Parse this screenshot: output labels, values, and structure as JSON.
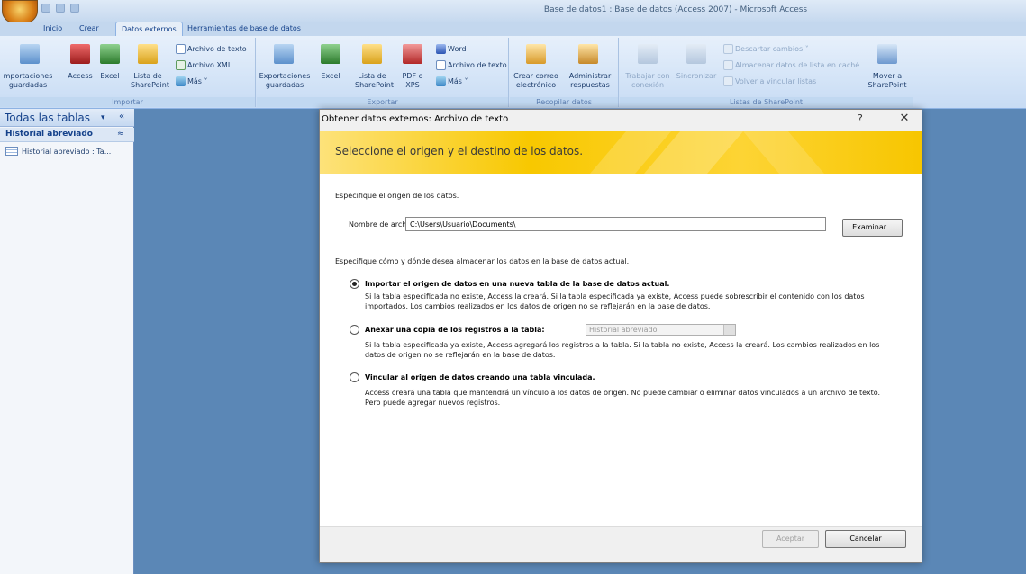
{
  "window": {
    "title": "Base de datos1 : Base de datos (Access 2007) - Microsoft Access"
  },
  "tabs": [
    {
      "label": "Inicio"
    },
    {
      "label": "Crear"
    },
    {
      "label": "Datos externos"
    },
    {
      "label": "Herramientas de base de datos"
    }
  ],
  "ribbon": {
    "importar": {
      "label": "Importar",
      "importaciones": "mportaciones",
      "importaciones_2": "guardadas",
      "access": "Access",
      "excel": "Excel",
      "lista": "Lista de",
      "lista_2": "SharePoint",
      "archivo_texto": "Archivo de texto",
      "archivo_xml": "Archivo XML",
      "mas": "Más ˅"
    },
    "exportar": {
      "label": "Exportar",
      "exportaciones": "Exportaciones",
      "exportaciones_2": "guardadas",
      "excel": "Excel",
      "lista": "Lista de",
      "lista_2": "SharePoint",
      "pdf": "PDF o",
      "pdf_2": "XPS",
      "word": "Word",
      "archivo_texto": "Archivo de texto",
      "mas": "Más ˅"
    },
    "recopilar": {
      "label": "Recopilar datos",
      "crear_correo": "Crear correo",
      "crear_correo_2": "electrónico",
      "administrar": "Administrar",
      "administrar_2": "respuestas"
    },
    "sharepoint": {
      "label": "Listas de SharePoint",
      "trabajar": "Trabajar con",
      "trabajar_2": "conexión",
      "sincronizar": "Sincronizar",
      "descartar": "Descartar cambios ˅",
      "almacenar": "Almacenar datos de lista en caché",
      "volver": "Volver a vincular listas",
      "mover": "Mover a",
      "mover_2": "SharePoint"
    }
  },
  "nav": {
    "title": "Todas las tablas",
    "dropdown": "▾",
    "collapse": "«",
    "group": "Historial abreviado",
    "group_toggle": "≈",
    "item": "Historial abreviado : Ta..."
  },
  "dialog": {
    "title": "Obtener datos externos: Archivo de texto",
    "help": "?",
    "close": "✕",
    "banner": "Seleccione el origen y el destino de los datos.",
    "specify_source": "Especifique el origen de los datos.",
    "file_label": "Nombre de archivo:",
    "file_value": "C:\\Users\\Usuario\\Documents\\",
    "browse": "Examinar...",
    "specify_store": "Especifique cómo y dónde desea almacenar los datos en la base de datos actual.",
    "options": [
      {
        "label": "Importar el origen de datos en una nueva tabla de la base de datos actual.",
        "desc": "Si la tabla especificada no existe, Access la creará. Si la tabla especificada ya existe, Access puede sobrescribir el contenido con los datos importados. Los cambios realizados en los datos de origen no se reflejarán en la base de datos.",
        "selected": true
      },
      {
        "label": "Anexar una copia de los registros a la tabla:",
        "combo": "Historial abreviado",
        "desc": "Si la tabla especificada ya existe, Access agregará los registros a la tabla. Si la tabla no existe, Access la creará. Los cambios realizados en los datos de origen no se reflejarán en la base de datos.",
        "selected": false
      },
      {
        "label": "Vincular al origen de datos creando una tabla vinculada.",
        "desc": "Access creará una tabla que mantendrá un vínculo a los datos de origen. No puede cambiar o eliminar datos vinculados a un archivo de texto. Pero puede agregar nuevos registros.",
        "selected": false
      }
    ],
    "accept": "Aceptar",
    "cancel": "Cancelar"
  }
}
